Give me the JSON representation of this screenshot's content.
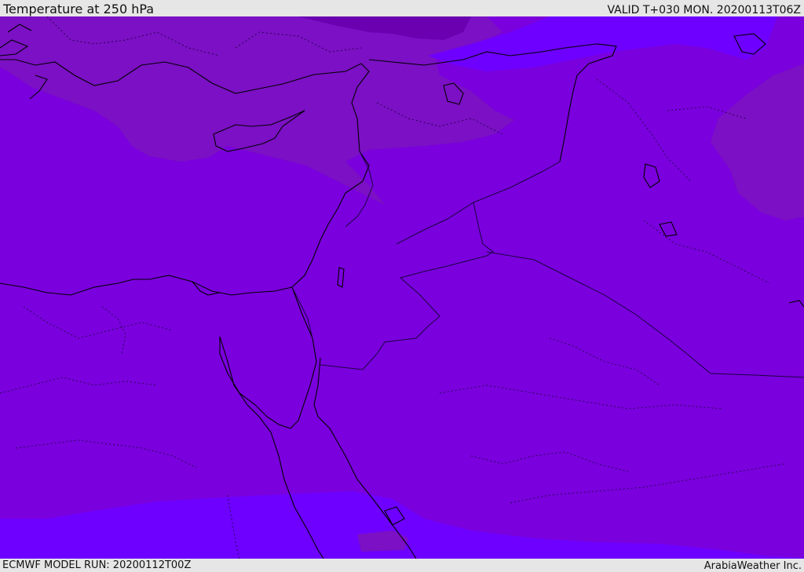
{
  "header": {
    "title": "Temperature at 250 hPa",
    "valid_time": "VALID T+030 MON. 20200113T06Z"
  },
  "footer": {
    "model_run": "ECMWF MODEL RUN: 20200112T00Z",
    "credit": "ArabiaWeather Inc."
  },
  "map": {
    "variable": "temperature",
    "level": "250 hPa",
    "colors": {
      "base_fill": "#7a00dd",
      "cold_band": "#7b10c4",
      "coldest_core": "#6a00b0",
      "warm_band": "#6e00ff",
      "coastline": "#000000",
      "borders": "#1a0040"
    }
  }
}
